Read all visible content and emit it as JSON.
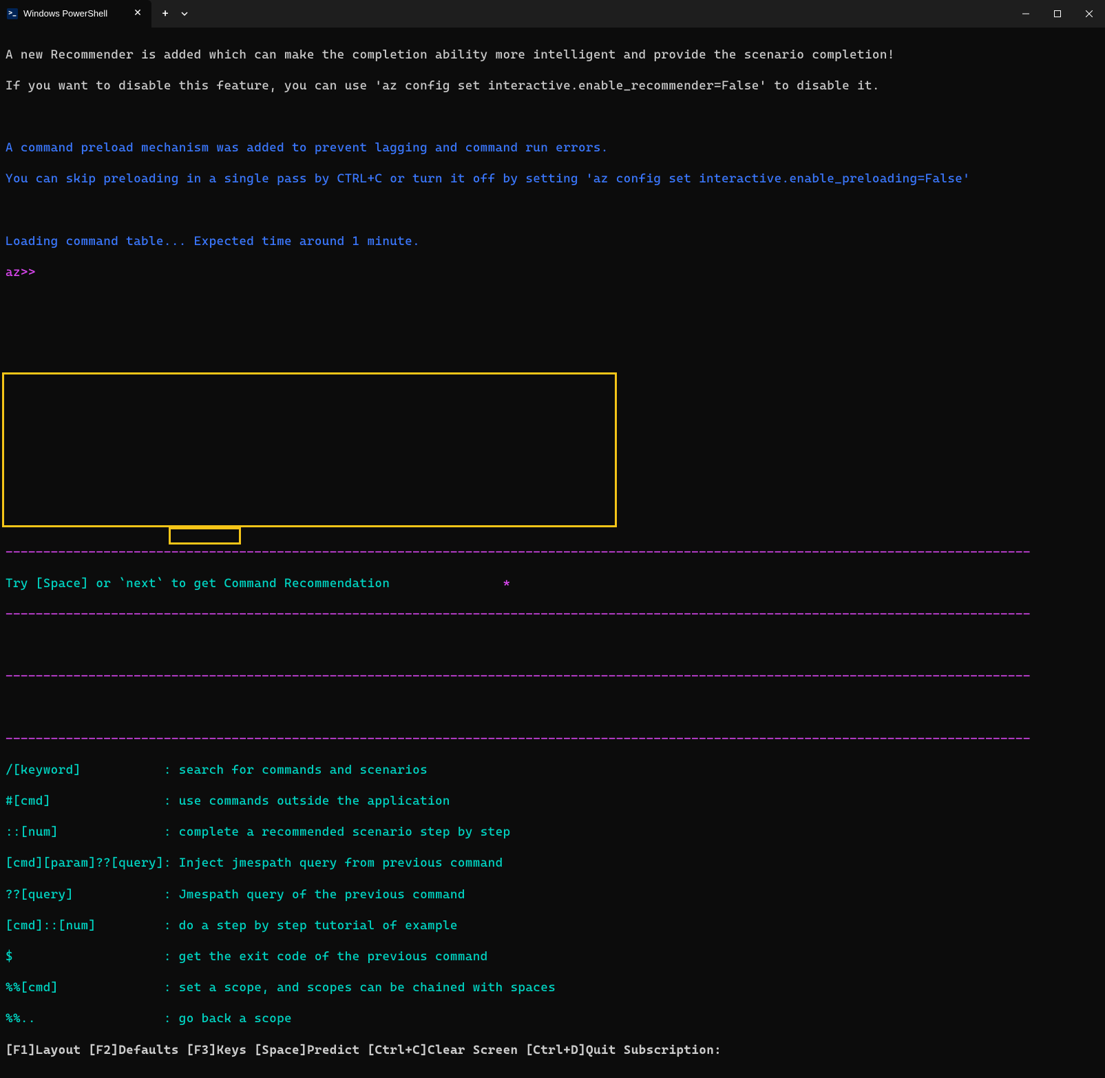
{
  "titlebar": {
    "tab_title": "Windows PowerShell",
    "tab_icon_text": ">_"
  },
  "terminal": {
    "line1": "A new Recommender is added which can make the completion ability more intelligent and provide the scenario completion!",
    "line2": "If you want to disable this feature, you can use 'az config set interactive.enable_recommender=False' to disable it.",
    "line3": "A command preload mechanism was added to prevent lagging and command run errors.",
    "line4": "You can skip preloading in a single pass by CTRL+C or turn it off by setting 'az config set interactive.enable_preloading=False'",
    "line5": "Loading command table... Expected time around 1 minute.",
    "prompt": "az>>",
    "recommendation": "Try [Space] or `next` to get Command Recommendation",
    "asterisk": "*"
  },
  "help": {
    "rows": [
      {
        "key": "/[keyword]",
        "desc": "search for commands and scenarios"
      },
      {
        "key": "#[cmd]",
        "desc": "use commands outside the application"
      },
      {
        "key": "::[num]",
        "desc": "complete a recommended scenario step by step"
      },
      {
        "key": "[cmd][param]??[query]",
        "desc": "Inject jmespath query from previous command"
      },
      {
        "key": "??[query]",
        "desc": "Jmespath query of the previous command"
      },
      {
        "key": "[cmd]::[num]",
        "desc": "do a step by step tutorial of example"
      },
      {
        "key": "$",
        "desc": "get the exit code of the previous command"
      },
      {
        "key": "%%[cmd]",
        "desc": "set a scope, and scopes can be chained with spaces"
      },
      {
        "key": "%%..",
        "desc": "go back a scope"
      }
    ]
  },
  "footer": {
    "items": [
      {
        "key": "[F1]",
        "label": "Layout"
      },
      {
        "key": "[F2]",
        "label": "Defaults"
      },
      {
        "key": "[F3]",
        "label": "Keys"
      },
      {
        "key": "[Space]",
        "label": "Predict"
      },
      {
        "key": "[Ctrl+C]",
        "label": "Clear Screen"
      },
      {
        "key": "[Ctrl+D]",
        "label": "Quit"
      }
    ],
    "subscription_label": "Subscription:"
  },
  "dashes": "----------------------------------------------------------------------------------------------------------------------------------------"
}
